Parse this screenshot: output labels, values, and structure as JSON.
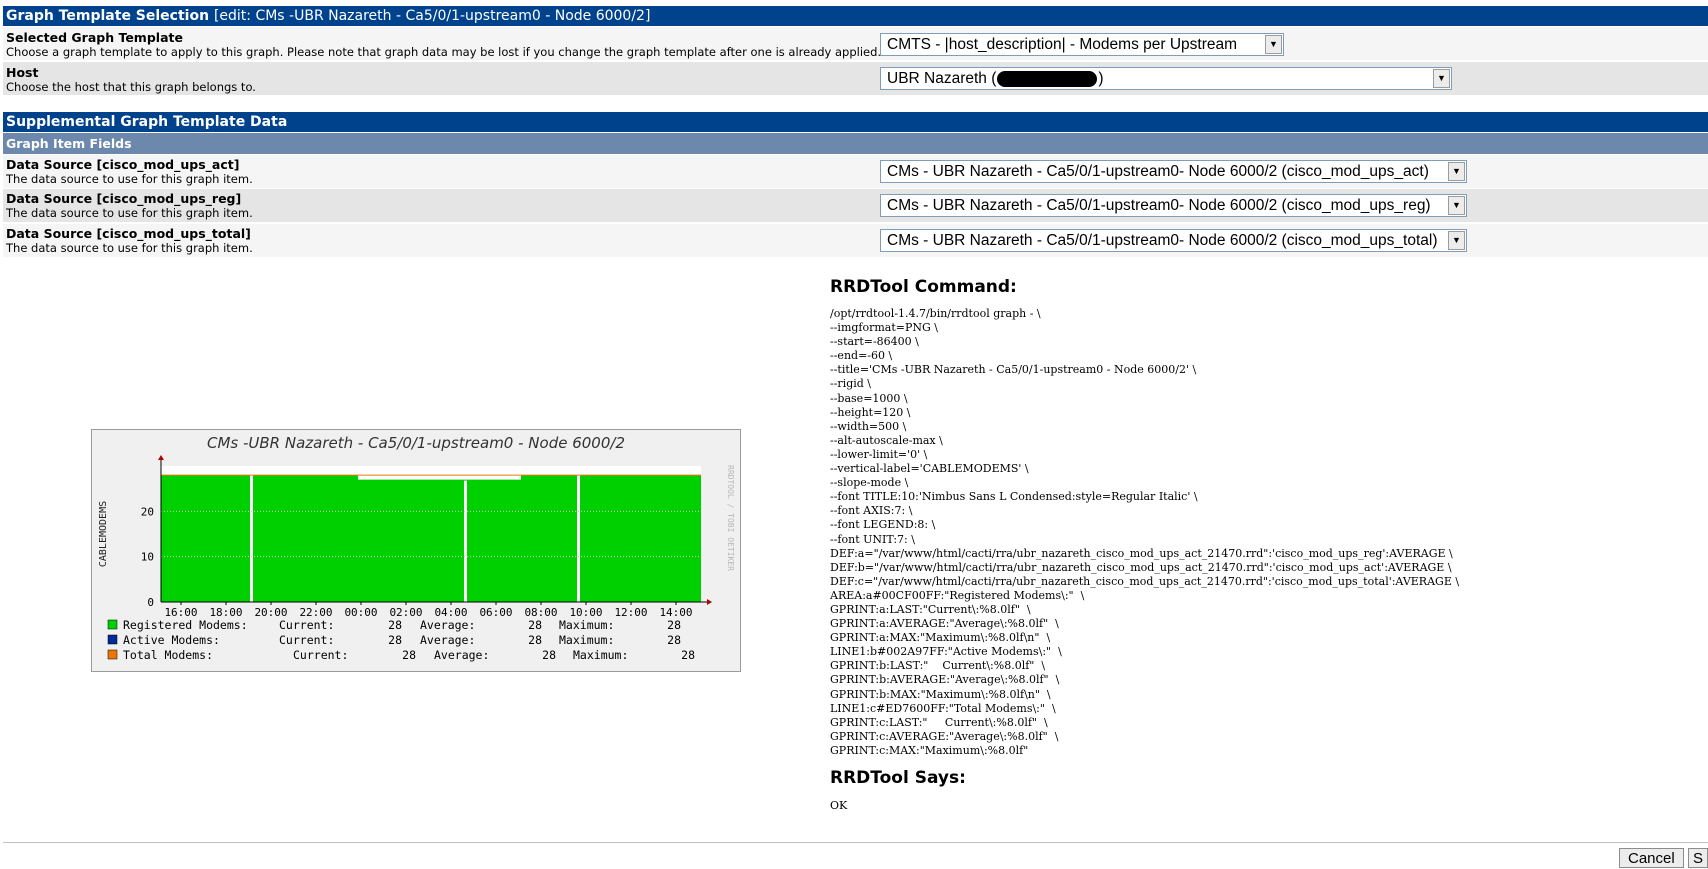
{
  "template_section": {
    "title": "Graph Template Selection",
    "subtitle": "[edit: CMs -UBR Nazareth - Ca5/0/1-upstream0 - Node 6000/2]",
    "selected_template_label": "Selected Graph Template",
    "selected_template_desc": "Choose a graph template to apply to this graph. Please note that graph data may be lost if you change the graph template after one is already applied.",
    "selected_template_value": "CMTS - |host_description| - Modems per Upstream",
    "host_label": "Host",
    "host_desc": "Choose the host that this graph belongs to.",
    "host_value_prefix": "UBR Nazareth (",
    "host_value_suffix": ")"
  },
  "supplemental_section": {
    "title": "Supplemental Graph Template Data",
    "subheader": "Graph Item Fields",
    "rows": [
      {
        "label": "Data Source [cisco_mod_ups_act]",
        "desc": "The data source to use for this graph item.",
        "value": "CMs - UBR Nazareth - Ca5/0/1-upstream0- Node 6000/2 (cisco_mod_ups_act)"
      },
      {
        "label": "Data Source [cisco_mod_ups_reg]",
        "desc": "The data source to use for this graph item.",
        "value": "CMs - UBR Nazareth - Ca5/0/1-upstream0- Node 6000/2 (cisco_mod_ups_reg)"
      },
      {
        "label": "Data Source [cisco_mod_ups_total]",
        "desc": "The data source to use for this graph item.",
        "value": "CMs - UBR Nazareth - Ca5/0/1-upstream0- Node 6000/2 (cisco_mod_ups_total)"
      }
    ]
  },
  "rrdtool": {
    "command_heading": "RRDTool Command:",
    "command_lines": [
      "/opt/rrdtool-1.4.7/bin/rrdtool graph - \\",
      "--imgformat=PNG \\",
      "--start=-86400 \\",
      "--end=-60 \\",
      "--title='CMs -UBR Nazareth - Ca5/0/1-upstream0 - Node 6000/2' \\",
      "--rigid \\",
      "--base=1000 \\",
      "--height=120 \\",
      "--width=500 \\",
      "--alt-autoscale-max \\",
      "--lower-limit='0' \\",
      "--vertical-label='CABLEMODEMS' \\",
      "--slope-mode \\",
      "--font TITLE:10:'Nimbus Sans L Condensed:style=Regular Italic' \\",
      "--font AXIS:7: \\",
      "--font LEGEND:8: \\",
      "--font UNIT:7: \\",
      "DEF:a=\"/var/www/html/cacti/rra/ubr_nazareth_cisco_mod_ups_act_21470.rrd\":'cisco_mod_ups_reg':AVERAGE \\",
      "DEF:b=\"/var/www/html/cacti/rra/ubr_nazareth_cisco_mod_ups_act_21470.rrd\":'cisco_mod_ups_act':AVERAGE \\",
      "DEF:c=\"/var/www/html/cacti/rra/ubr_nazareth_cisco_mod_ups_act_21470.rrd\":'cisco_mod_ups_total':AVERAGE \\",
      "AREA:a#00CF00FF:\"Registered Modems\\:\"  \\",
      "GPRINT:a:LAST:\"Current\\:%8.0lf\"  \\",
      "GPRINT:a:AVERAGE:\"Average\\:%8.0lf\"  \\",
      "GPRINT:a:MAX:\"Maximum\\:%8.0lf\\n\"  \\",
      "LINE1:b#002A97FF:\"Active Modems\\:\"  \\",
      "GPRINT:b:LAST:\"    Current\\:%8.0lf\"  \\",
      "GPRINT:b:AVERAGE:\"Average\\:%8.0lf\"  \\",
      "GPRINT:b:MAX:\"Maximum\\:%8.0lf\\n\"  \\",
      "LINE1:c#ED7600FF:\"Total Modems\\:\"  \\",
      "GPRINT:c:LAST:\"     Current\\:%8.0lf\"  \\",
      "GPRINT:c:AVERAGE:\"Average\\:%8.0lf\"  \\",
      "GPRINT:c:MAX:\"Maximum\\:%8.0lf\""
    ],
    "says_heading": "RRDTool Says:",
    "says_value": "OK"
  },
  "footer": {
    "cancel_label": "Cancel",
    "save_label": "S"
  },
  "chart_data": {
    "type": "area",
    "title": "CMs -UBR Nazareth - Ca5/0/1-upstream0 - Node 6000/2",
    "ylabel": "CABLEMODEMS",
    "watermark": "RRDTOOL / TOBI OETIKER",
    "ylim": [
      0,
      28
    ],
    "y_ticks": [
      "0",
      "10",
      "20"
    ],
    "x_ticks": [
      "16:00",
      "18:00",
      "20:00",
      "22:00",
      "00:00",
      "02:00",
      "04:00",
      "06:00",
      "08:00",
      "10:00",
      "12:00",
      "14:00"
    ],
    "series": [
      {
        "name": "Registered Modems:",
        "color": "#00CF00",
        "current": "28",
        "average": "28",
        "maximum": "28"
      },
      {
        "name": "Active Modems:",
        "color": "#002A97",
        "current": "28",
        "average": "28",
        "maximum": "28"
      },
      {
        "name": "Total Modems:",
        "color": "#ED7600",
        "current": "28",
        "average": "28",
        "maximum": "28"
      }
    ],
    "legend_labels": {
      "current": "Current:",
      "average": "Average:",
      "maximum": "Maximum:"
    }
  }
}
